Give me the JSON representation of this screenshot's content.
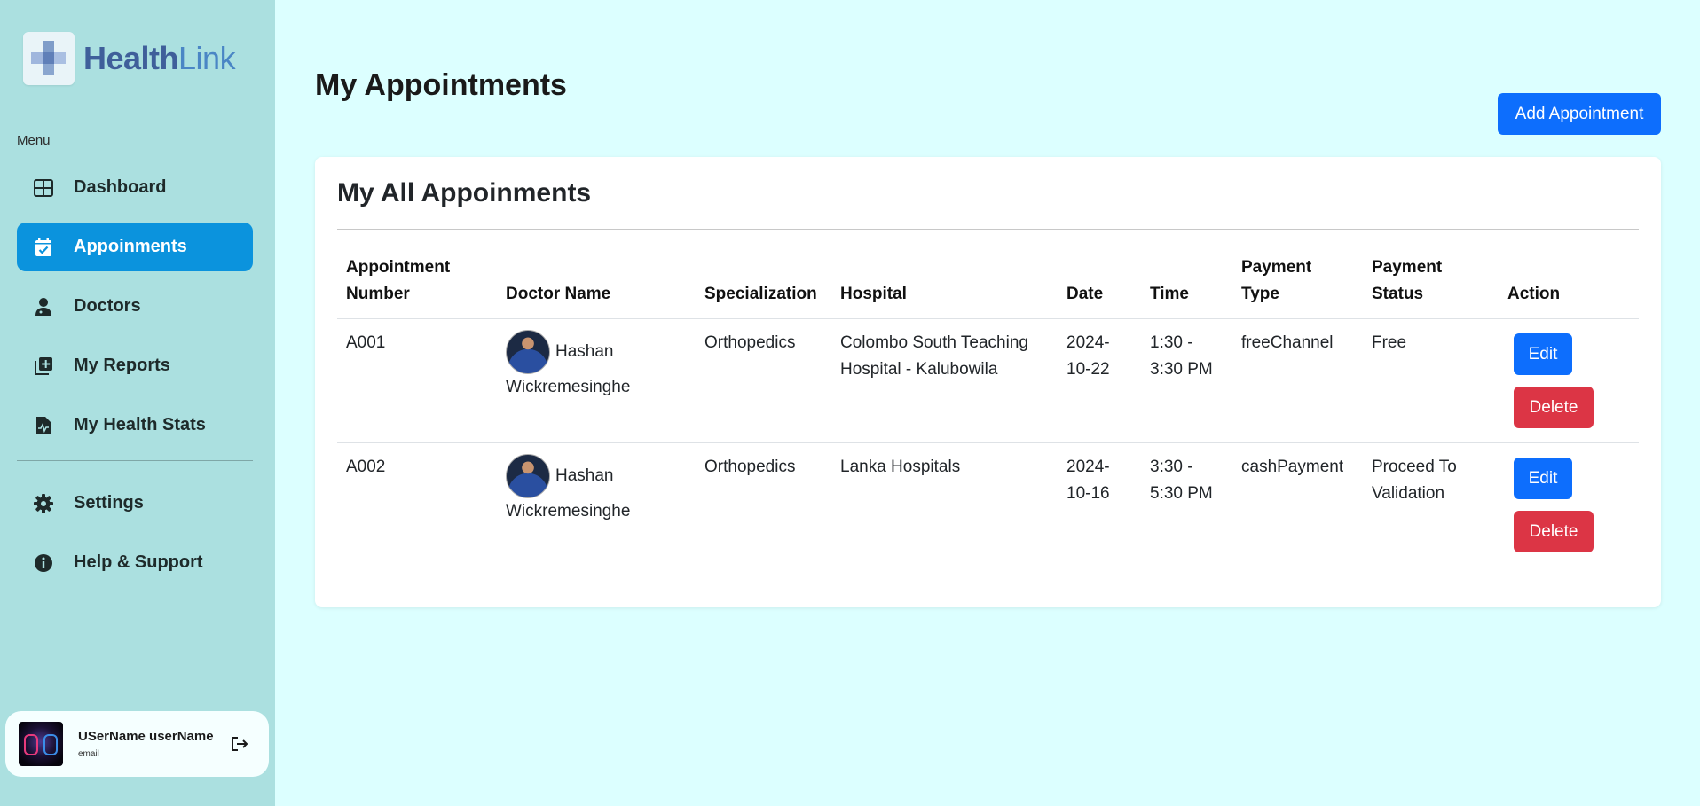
{
  "brand": {
    "name_part1": "Health",
    "name_part2": "Link",
    "logo_icon": "cross-pixel-logo"
  },
  "sidebar": {
    "menu_caption": "Menu",
    "items": [
      {
        "label": "Dashboard",
        "icon": "grid-icon",
        "active": false
      },
      {
        "label": "Appoinments",
        "icon": "calendar-check-icon",
        "active": true
      },
      {
        "label": "Doctors",
        "icon": "doctor-icon",
        "active": false
      },
      {
        "label": "My Reports",
        "icon": "add-report-icon",
        "active": false
      },
      {
        "label": "My Health Stats",
        "icon": "file-medical-icon",
        "active": false
      }
    ],
    "bottom_items": [
      {
        "label": "Settings",
        "icon": "gear-icon"
      },
      {
        "label": "Help & Support",
        "icon": "info-icon"
      }
    ],
    "user": {
      "name": "USerName userName",
      "email": "email",
      "logout_icon": "logout-icon"
    }
  },
  "main": {
    "title": "My Appointments",
    "add_button": "Add Appointment",
    "card_title": "My All Appoinments",
    "table": {
      "headers": {
        "number_line1": "Appointment",
        "number_line2": "Number",
        "doctor": "Doctor Name",
        "specialization": "Specialization",
        "hospital": "Hospital",
        "date": "Date",
        "time": "Time",
        "payment_type_line1": "Payment",
        "payment_type_line2": "Type",
        "payment_status_line1": "Payment",
        "payment_status_line2": "Status",
        "action": "Action"
      },
      "rows": [
        {
          "number": "A001",
          "doctor_first": "Hashan",
          "doctor_last": "Wickremesinghe",
          "specialization": "Orthopedics",
          "hospital_line1": "Colombo South Teaching",
          "hospital_line2": "Hospital - Kalubowila",
          "date_line1": "2024-",
          "date_line2": "10-22",
          "time_line1": "1:30 -",
          "time_line2": "3:30 PM",
          "payment_type": "freeChannel",
          "payment_status_line1": "Free",
          "payment_status_line2": "",
          "edit": "Edit",
          "delete": "Delete"
        },
        {
          "number": "A002",
          "doctor_first": "Hashan",
          "doctor_last": "Wickremesinghe",
          "specialization": "Orthopedics",
          "hospital_line1": "Lanka Hospitals",
          "hospital_line2": "",
          "date_line1": "2024-",
          "date_line2": "10-16",
          "time_line1": "3:30 -",
          "time_line2": "5:30 PM",
          "payment_type": "cashPayment",
          "payment_status_line1": "Proceed To",
          "payment_status_line2": "Validation",
          "edit": "Edit",
          "delete": "Delete"
        }
      ]
    }
  },
  "colors": {
    "page_bg": "#dcffff",
    "sidebar_bg": "#abe0e0",
    "active_nav": "#0b93dd",
    "primary": "#0d6efd",
    "danger": "#dc3545"
  }
}
